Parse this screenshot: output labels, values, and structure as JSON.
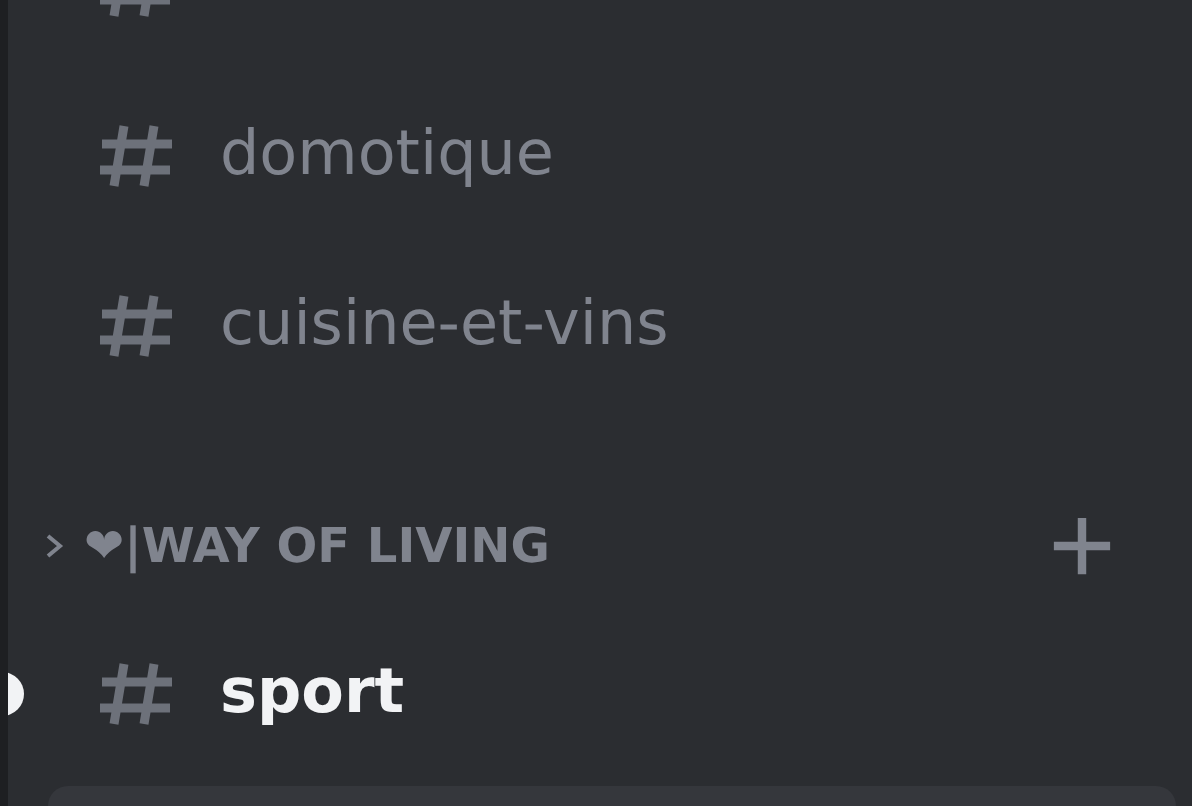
{
  "channels_before": [
    {
      "unread": false
    },
    {
      "name": "domotique",
      "unread": false
    },
    {
      "name": "cuisine-et-vins",
      "unread": false
    }
  ],
  "category": {
    "label": "❤|WAY OF LIVING",
    "expanded": false
  },
  "channels_after": [
    {
      "name": "sport",
      "unread": true
    }
  ]
}
